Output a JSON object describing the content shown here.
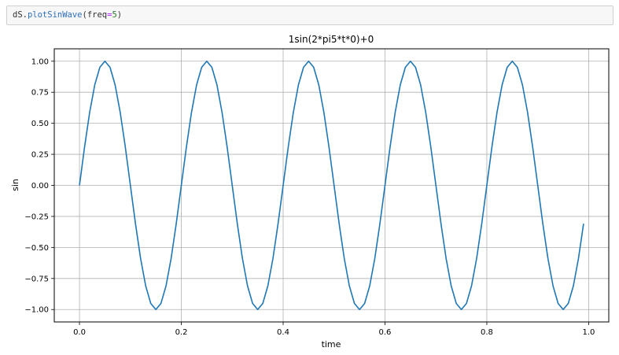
{
  "notebook": {
    "code_tokens": [
      {
        "text": "dS.",
        "kind": "plain"
      },
      {
        "text": "plotSinWave",
        "kind": "fn"
      },
      {
        "text": "(freq",
        "kind": "plain"
      },
      {
        "text": "=",
        "kind": "op"
      },
      {
        "text": "5",
        "kind": "num"
      },
      {
        "text": ")",
        "kind": "plain"
      }
    ]
  },
  "chart_data": {
    "type": "line",
    "title": "1sin(2*pi5*t*0)+0",
    "xlabel": "time",
    "ylabel": "sin",
    "xlim": [
      -0.0495,
      1.0395
    ],
    "ylim": [
      -1.1,
      1.1
    ],
    "xticks": [
      0.0,
      0.2,
      0.4,
      0.6,
      0.8,
      1.0
    ],
    "xtick_labels": [
      "0.0",
      "0.2",
      "0.4",
      "0.6",
      "0.8",
      "1.0"
    ],
    "yticks": [
      1.0,
      0.75,
      0.5,
      0.25,
      0.0,
      -0.25,
      -0.5,
      -0.75,
      -1.0
    ],
    "ytick_labels": [
      "1.00",
      "0.75",
      "0.50",
      "0.25",
      "0.00",
      "−0.25",
      "−0.50",
      "−0.75",
      "−1.00"
    ],
    "grid": true,
    "legend": "none",
    "series": [
      {
        "color": "#1f77b4",
        "x": [
          0.0,
          0.01,
          0.02,
          0.03,
          0.04,
          0.05,
          0.06,
          0.07,
          0.08,
          0.09,
          0.1,
          0.11,
          0.12,
          0.13,
          0.14,
          0.15,
          0.16,
          0.17,
          0.18,
          0.19,
          0.2,
          0.21,
          0.22,
          0.23,
          0.24,
          0.25,
          0.26,
          0.27,
          0.28,
          0.29,
          0.3,
          0.31,
          0.32,
          0.33,
          0.34,
          0.35,
          0.36,
          0.37,
          0.38,
          0.39,
          0.4,
          0.41,
          0.42,
          0.43,
          0.44,
          0.45,
          0.46,
          0.47,
          0.48,
          0.49,
          0.5,
          0.51,
          0.52,
          0.53,
          0.54,
          0.55,
          0.56,
          0.57,
          0.58,
          0.59,
          0.6,
          0.61,
          0.62,
          0.63,
          0.64,
          0.65,
          0.66,
          0.67,
          0.68,
          0.69,
          0.7,
          0.71,
          0.72,
          0.73,
          0.74,
          0.75,
          0.76,
          0.77,
          0.78,
          0.79,
          0.8,
          0.81,
          0.82,
          0.83,
          0.84,
          0.85,
          0.86,
          0.87,
          0.88,
          0.89,
          0.9,
          0.91,
          0.92,
          0.93,
          0.94,
          0.95,
          0.96,
          0.97,
          0.98,
          0.99
        ],
        "y": [
          0.0,
          0.309,
          0.588,
          0.809,
          0.951,
          1.0,
          0.951,
          0.809,
          0.588,
          0.309,
          0.0,
          -0.309,
          -0.588,
          -0.809,
          -0.951,
          -1.0,
          -0.951,
          -0.809,
          -0.588,
          -0.309,
          0.0,
          0.309,
          0.588,
          0.809,
          0.951,
          1.0,
          0.951,
          0.809,
          0.588,
          0.309,
          0.0,
          -0.309,
          -0.588,
          -0.809,
          -0.951,
          -1.0,
          -0.951,
          -0.809,
          -0.588,
          -0.309,
          0.0,
          0.309,
          0.588,
          0.809,
          0.951,
          1.0,
          0.951,
          0.809,
          0.588,
          0.309,
          0.0,
          -0.309,
          -0.588,
          -0.809,
          -0.951,
          -1.0,
          -0.951,
          -0.809,
          -0.588,
          -0.309,
          0.0,
          0.309,
          0.588,
          0.809,
          0.951,
          1.0,
          0.951,
          0.809,
          0.588,
          0.309,
          0.0,
          -0.309,
          -0.588,
          -0.809,
          -0.951,
          -1.0,
          -0.951,
          -0.809,
          -0.588,
          -0.309,
          0.0,
          0.309,
          0.588,
          0.809,
          0.951,
          1.0,
          0.951,
          0.809,
          0.588,
          0.309,
          0.0,
          -0.309,
          -0.588,
          -0.809,
          -0.951,
          -1.0,
          -0.951,
          -0.809,
          -0.588,
          -0.309
        ]
      }
    ]
  }
}
